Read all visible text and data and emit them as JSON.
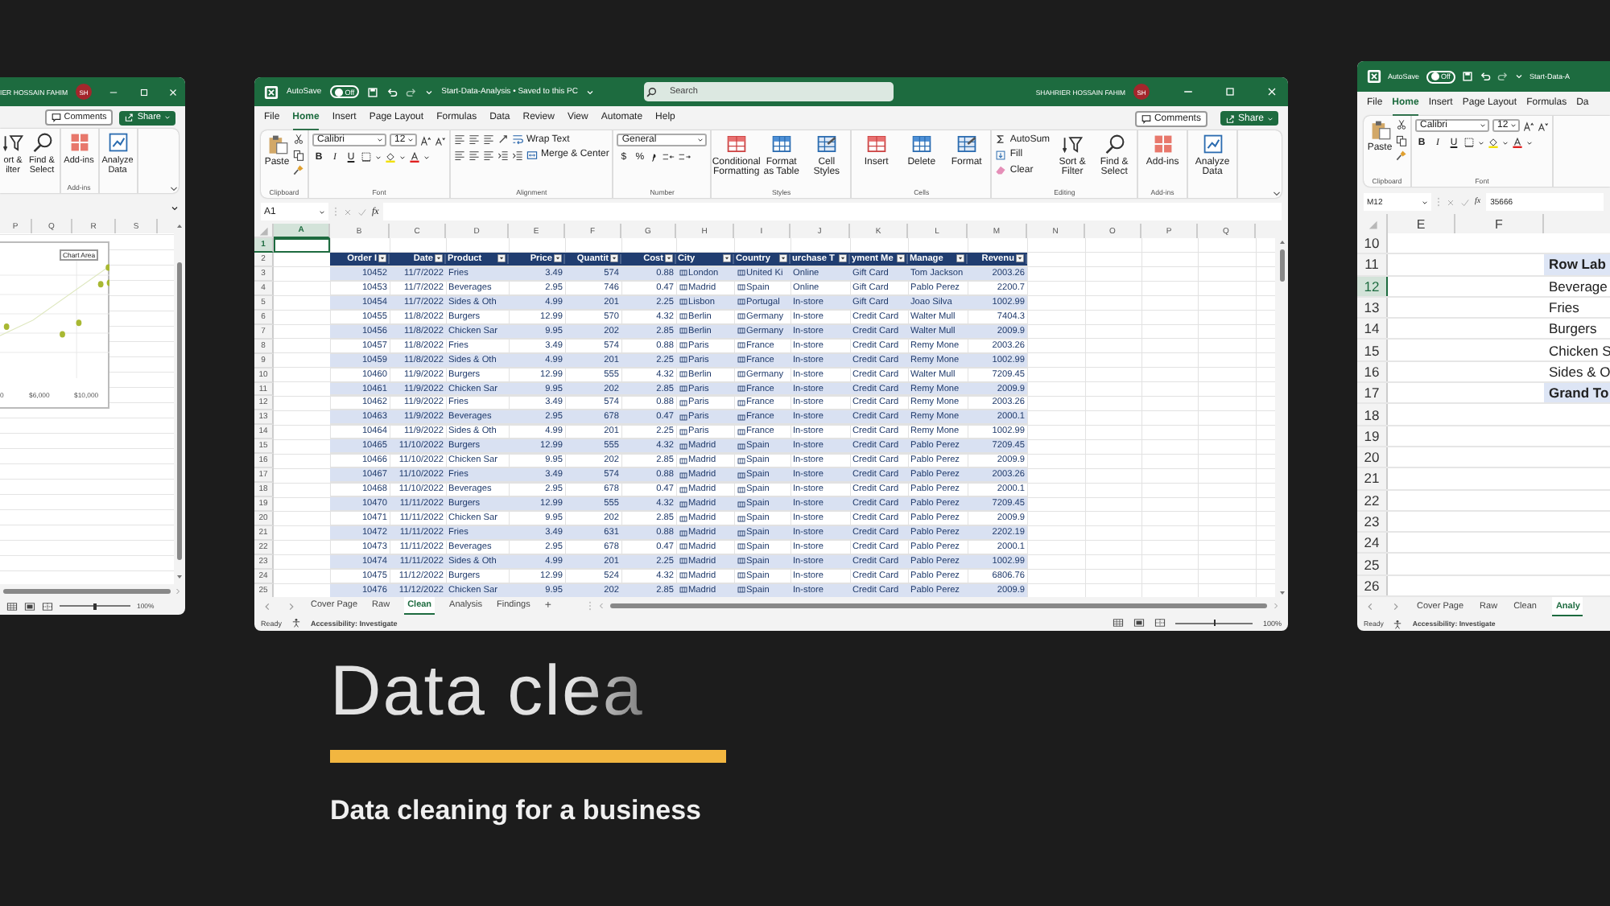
{
  "left_window": {
    "user": "IER HOSSAIN FAHIM",
    "avatar": "SH",
    "comments": "Comments",
    "share": "Share",
    "ribbon": [
      {
        "kind": "sort_find",
        "items": [
          "ort & ilter",
          "Find & Select"
        ]
      },
      {
        "kind": "large",
        "label": "Add-ins",
        "items": [
          "Add-ins"
        ]
      },
      {
        "kind": "large",
        "items": [
          "Analyze Data"
        ]
      }
    ],
    "column_letters": [
      "P",
      "Q",
      "R",
      "S"
    ],
    "chart": {
      "tooltip": "Chart Area",
      "x_labels": [
        "0",
        "$6,000",
        "$10,000"
      ]
    },
    "zoom_slider": {
      "level": 0.5
    },
    "zoom": "100%"
  },
  "center_window": {
    "title_bar": {
      "autosave_label": "AutoSave",
      "autosave": {
        "on": false,
        "label": "Off"
      },
      "title": "Start-Data-Analysis • Saved to this PC",
      "search": {
        "placeholder": "Search"
      },
      "user": "SHAHRIER HOSSAIN FAHIM",
      "avatar": "SH"
    },
    "menu_tabs": [
      {
        "label": "File",
        "selected": false
      },
      {
        "label": "Home",
        "selected": true
      },
      {
        "label": "Insert",
        "selected": false
      },
      {
        "label": "Page Layout",
        "selected": false
      },
      {
        "label": "Formulas",
        "selected": false
      },
      {
        "label": "Data",
        "selected": false
      },
      {
        "label": "Review",
        "selected": false
      },
      {
        "label": "View",
        "selected": false
      },
      {
        "label": "Automate",
        "selected": false
      },
      {
        "label": "Help",
        "selected": false
      }
    ],
    "comments": "Comments",
    "share": "Share",
    "ribbon": [
      {
        "kind": "clipboard",
        "label": "Clipboard",
        "items": [
          "Paste"
        ]
      },
      {
        "kind": "font",
        "label": "Font",
        "items": [
          "Calibri",
          "12",
          "B",
          "I",
          "U"
        ]
      },
      {
        "kind": "alignment",
        "label": "Alignment",
        "items": [
          "Wrap Text",
          "Merge & Center"
        ]
      },
      {
        "kind": "number",
        "label": "Number",
        "items": [
          "General",
          "$",
          "%"
        ]
      },
      {
        "kind": "large",
        "label": "Styles",
        "items": [
          "Conditional Formatting",
          "Format as Table",
          "Cell Styles"
        ]
      },
      {
        "kind": "large",
        "label": "Cells",
        "items": [
          "Insert",
          "Delete",
          "Format"
        ]
      },
      {
        "kind": "editing",
        "label": "Editing",
        "items": [
          "AutoSum",
          "Fill",
          "Clear",
          "Sort & Filter",
          "Find & Select"
        ]
      },
      {
        "kind": "large",
        "label": "Add-ins",
        "items": [
          "Add-ins"
        ]
      },
      {
        "kind": "large",
        "items": [
          "Analyze Data"
        ]
      }
    ],
    "name_box": "A1",
    "function_label": "fx",
    "grid": {
      "column_letters": [
        {
          "label": "A",
          "selected": true
        },
        {
          "label": "B",
          "selected": false
        },
        {
          "label": "C",
          "selected": false
        },
        {
          "label": "D",
          "selected": false
        },
        {
          "label": "E",
          "selected": false
        },
        {
          "label": "F",
          "selected": false
        },
        {
          "label": "G",
          "selected": false
        },
        {
          "label": "H",
          "selected": false
        },
        {
          "label": "I",
          "selected": false
        },
        {
          "label": "J",
          "selected": false
        },
        {
          "label": "K",
          "selected": false
        },
        {
          "label": "L",
          "selected": false
        },
        {
          "label": "M",
          "selected": false
        },
        {
          "label": "N",
          "selected": false
        },
        {
          "label": "O",
          "selected": false
        },
        {
          "label": "P",
          "selected": false
        },
        {
          "label": "Q",
          "selected": false
        }
      ],
      "row_numbers": [
        {
          "label": "1",
          "selected": true
        },
        {
          "label": "2",
          "selected": false
        },
        {
          "label": "3",
          "selected": false
        },
        {
          "label": "4",
          "selected": false
        },
        {
          "label": "5",
          "selected": false
        },
        {
          "label": "6",
          "selected": false
        },
        {
          "label": "7",
          "selected": false
        },
        {
          "label": "8",
          "selected": false
        },
        {
          "label": "9",
          "selected": false
        },
        {
          "label": "10",
          "selected": false
        },
        {
          "label": "11",
          "selected": false
        },
        {
          "label": "12",
          "selected": false
        },
        {
          "label": "13",
          "selected": false
        },
        {
          "label": "14",
          "selected": false
        },
        {
          "label": "15",
          "selected": false
        },
        {
          "label": "16",
          "selected": false
        },
        {
          "label": "17",
          "selected": false
        },
        {
          "label": "18",
          "selected": false
        },
        {
          "label": "19",
          "selected": false
        },
        {
          "label": "20",
          "selected": false
        },
        {
          "label": "21",
          "selected": false
        },
        {
          "label": "22",
          "selected": false
        },
        {
          "label": "23",
          "selected": false
        },
        {
          "label": "24",
          "selected": false
        },
        {
          "label": "25",
          "selected": false
        }
      ],
      "table": {
        "columns": [
          {
            "label": "Order I",
            "kind": "number"
          },
          {
            "label": "Date",
            "kind": "number"
          },
          {
            "label": "Product",
            "kind": "text"
          },
          {
            "label": "Price",
            "kind": "number"
          },
          {
            "label": "Quantit",
            "kind": "number"
          },
          {
            "label": "Cost",
            "kind": "number"
          },
          {
            "label": "City",
            "kind": "geo"
          },
          {
            "label": "Country",
            "kind": "geo"
          },
          {
            "label": "urchase T",
            "kind": "text"
          },
          {
            "label": "yment Me",
            "kind": "text"
          },
          {
            "label": "Manage",
            "kind": "text"
          },
          {
            "label": "Revenu",
            "kind": "number"
          }
        ],
        "rows": [
          [
            "10452",
            "11/7/2022",
            "Fries",
            "3.49",
            "574",
            "0.88",
            "London",
            "United Ki",
            "Online",
            "Gift Card",
            "Tom Jackson",
            "2003.26"
          ],
          [
            "10453",
            "11/7/2022",
            "Beverages",
            "2.95",
            "746",
            "0.47",
            "Madrid",
            "Spain",
            "Online",
            "Gift Card",
            "Pablo Perez",
            "2200.7"
          ],
          [
            "10454",
            "11/7/2022",
            "Sides & Oth",
            "4.99",
            "201",
            "2.25",
            "Lisbon",
            "Portugal",
            "In-store",
            "Gift Card",
            "Joao Silva",
            "1002.99"
          ],
          [
            "10455",
            "11/8/2022",
            "Burgers",
            "12.99",
            "570",
            "4.32",
            "Berlin",
            "Germany",
            "In-store",
            "Credit Card",
            "Walter Mull",
            "7404.3"
          ],
          [
            "10456",
            "11/8/2022",
            "Chicken Sar",
            "9.95",
            "202",
            "2.85",
            "Berlin",
            "Germany",
            "In-store",
            "Credit Card",
            "Walter Mull",
            "2009.9"
          ],
          [
            "10457",
            "11/8/2022",
            "Fries",
            "3.49",
            "574",
            "0.88",
            "Paris",
            "France",
            "In-store",
            "Credit Card",
            "Remy Mone",
            "2003.26"
          ],
          [
            "10459",
            "11/8/2022",
            "Sides & Oth",
            "4.99",
            "201",
            "2.25",
            "Paris",
            "France",
            "In-store",
            "Credit Card",
            "Remy Mone",
            "1002.99"
          ],
          [
            "10460",
            "11/9/2022",
            "Burgers",
            "12.99",
            "555",
            "4.32",
            "Berlin",
            "Germany",
            "In-store",
            "Credit Card",
            "Walter Mull",
            "7209.45"
          ],
          [
            "10461",
            "11/9/2022",
            "Chicken Sar",
            "9.95",
            "202",
            "2.85",
            "Paris",
            "France",
            "In-store",
            "Credit Card",
            "Remy Mone",
            "2009.9"
          ],
          [
            "10462",
            "11/9/2022",
            "Fries",
            "3.49",
            "574",
            "0.88",
            "Paris",
            "France",
            "In-store",
            "Credit Card",
            "Remy Mone",
            "2003.26"
          ],
          [
            "10463",
            "11/9/2022",
            "Beverages",
            "2.95",
            "678",
            "0.47",
            "Paris",
            "France",
            "In-store",
            "Credit Card",
            "Remy Mone",
            "2000.1"
          ],
          [
            "10464",
            "11/9/2022",
            "Sides & Oth",
            "4.99",
            "201",
            "2.25",
            "Paris",
            "France",
            "In-store",
            "Credit Card",
            "Remy Mone",
            "1002.99"
          ],
          [
            "10465",
            "11/10/2022",
            "Burgers",
            "12.99",
            "555",
            "4.32",
            "Madrid",
            "Spain",
            "In-store",
            "Credit Card",
            "Pablo Perez",
            "7209.45"
          ],
          [
            "10466",
            "11/10/2022",
            "Chicken Sar",
            "9.95",
            "202",
            "2.85",
            "Madrid",
            "Spain",
            "In-store",
            "Credit Card",
            "Pablo Perez",
            "2009.9"
          ],
          [
            "10467",
            "11/10/2022",
            "Fries",
            "3.49",
            "574",
            "0.88",
            "Madrid",
            "Spain",
            "In-store",
            "Credit Card",
            "Pablo Perez",
            "2003.26"
          ],
          [
            "10468",
            "11/10/2022",
            "Beverages",
            "2.95",
            "678",
            "0.47",
            "Madrid",
            "Spain",
            "In-store",
            "Credit Card",
            "Pablo Perez",
            "2000.1"
          ],
          [
            "10470",
            "11/11/2022",
            "Burgers",
            "12.99",
            "555",
            "4.32",
            "Madrid",
            "Spain",
            "In-store",
            "Credit Card",
            "Pablo Perez",
            "7209.45"
          ],
          [
            "10471",
            "11/11/2022",
            "Chicken Sar",
            "9.95",
            "202",
            "2.85",
            "Madrid",
            "Spain",
            "In-store",
            "Credit Card",
            "Pablo Perez",
            "2009.9"
          ],
          [
            "10472",
            "11/11/2022",
            "Fries",
            "3.49",
            "631",
            "0.88",
            "Madrid",
            "Spain",
            "In-store",
            "Credit Card",
            "Pablo Perez",
            "2202.19"
          ],
          [
            "10473",
            "11/11/2022",
            "Beverages",
            "2.95",
            "678",
            "0.47",
            "Madrid",
            "Spain",
            "In-store",
            "Credit Card",
            "Pablo Perez",
            "2000.1"
          ],
          [
            "10474",
            "11/11/2022",
            "Sides & Oth",
            "4.99",
            "201",
            "2.25",
            "Madrid",
            "Spain",
            "In-store",
            "Credit Card",
            "Pablo Perez",
            "1002.99"
          ],
          [
            "10475",
            "11/12/2022",
            "Burgers",
            "12.99",
            "524",
            "4.32",
            "Madrid",
            "Spain",
            "In-store",
            "Credit Card",
            "Pablo Perez",
            "6806.76"
          ],
          [
            "10476",
            "11/12/2022",
            "Chicken Sar",
            "9.95",
            "202",
            "2.85",
            "Madrid",
            "Spain",
            "In-store",
            "Credit Card",
            "Pablo Perez",
            "2009.9"
          ]
        ]
      }
    },
    "sheet_tabs": [
      {
        "label": "Cover Page",
        "selected": false
      },
      {
        "label": "Raw",
        "selected": false
      },
      {
        "label": "Clean",
        "selected": true
      },
      {
        "label": "Analysis",
        "selected": false
      },
      {
        "label": "Findings",
        "selected": false
      }
    ],
    "add_sheet": "+",
    "status": {
      "ready": "Ready",
      "accessibility": "Accessibility: Investigate",
      "zoom_slider": {
        "level": 0.5
      },
      "zoom": "100%"
    }
  },
  "right_window": {
    "autosave_label": "AutoSave",
    "autosave": {
      "on": false,
      "label": "Off"
    },
    "title": "Start-Data-A",
    "menu_tabs": [
      {
        "label": "File",
        "selected": false
      },
      {
        "label": "Home",
        "selected": true
      },
      {
        "label": "Insert",
        "selected": false
      },
      {
        "label": "Page Layout",
        "selected": false
      },
      {
        "label": "Formulas",
        "selected": false
      },
      {
        "label": "Da",
        "selected": false
      }
    ],
    "ribbon": [
      {
        "kind": "clipboard",
        "label": "Clipboard",
        "items": [
          "Paste"
        ]
      },
      {
        "kind": "font",
        "label": "Font",
        "items": [
          "Calibri",
          "12",
          "B",
          "I",
          "U"
        ]
      }
    ],
    "name_box": "M12",
    "function_label": "fx",
    "formula": "35666",
    "column_letters": [
      {
        "label": "E",
        "selected": false
      },
      {
        "label": "F",
        "selected": false
      }
    ],
    "row_numbers": [
      {
        "label": "10",
        "selected": false
      },
      {
        "label": "11",
        "selected": false
      },
      {
        "label": "12",
        "selected": true
      },
      {
        "label": "13",
        "selected": false
      },
      {
        "label": "14",
        "selected": false
      },
      {
        "label": "15",
        "selected": false
      },
      {
        "label": "16",
        "selected": false
      },
      {
        "label": "17",
        "selected": false
      },
      {
        "label": "18",
        "selected": false
      },
      {
        "label": "19",
        "selected": false
      },
      {
        "label": "20",
        "selected": false
      },
      {
        "label": "21",
        "selected": false
      },
      {
        "label": "22",
        "selected": false
      },
      {
        "label": "23",
        "selected": false
      },
      {
        "label": "24",
        "selected": false
      },
      {
        "label": "25",
        "selected": false
      },
      {
        "label": "26",
        "selected": false
      }
    ],
    "pivot": [
      {
        "label": "Row Lab",
        "kind": "header"
      },
      {
        "label": "Beverage",
        "kind": "item"
      },
      {
        "label": "Fries",
        "kind": "item"
      },
      {
        "label": "Burgers",
        "kind": "item"
      },
      {
        "label": "Chicken S",
        "kind": "item"
      },
      {
        "label": "Sides & O",
        "kind": "item"
      },
      {
        "label": "Grand To",
        "kind": "total"
      }
    ],
    "sheet_tabs": [
      {
        "label": "Cover Page",
        "selected": false
      },
      {
        "label": "Raw",
        "selected": false
      },
      {
        "label": "Clean",
        "selected": false
      },
      {
        "label": "Analy",
        "selected": true
      }
    ],
    "status": {
      "ready": "Ready",
      "accessibility": "Accessibility: Investigate"
    }
  },
  "caption": {
    "heading": "Data clea",
    "subtitle": "Data cleaning for a business"
  }
}
